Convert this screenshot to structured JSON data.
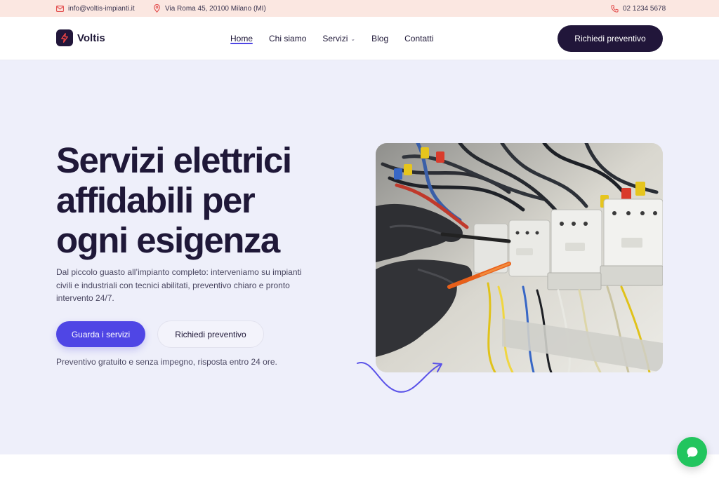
{
  "topbar": {
    "email": "info@voltis-impianti.it",
    "address": "Via Roma 45, 20100 Milano (MI)",
    "phone": "02 1234 5678",
    "email_icon": "mail-icon",
    "address_icon": "map-pin-icon",
    "phone_icon": "phone-icon"
  },
  "header": {
    "brand": "Voltis",
    "brand_icon": "lightning-bolt-icon",
    "nav": [
      {
        "label": "Home",
        "active": true
      },
      {
        "label": "Chi siamo"
      },
      {
        "label": "Servizi",
        "has_dropdown": true
      },
      {
        "label": "Blog"
      },
      {
        "label": "Contatti"
      }
    ],
    "cta": "Richiedi preventivo"
  },
  "hero": {
    "title_lines": [
      "Servizi elettrici",
      "affidabili per",
      "ogni esigenza"
    ],
    "description": "Dal piccolo guasto all’impianto completo: interveniamo su impianti civili e industriali con tecnici abilitati, preventivo chiaro e pronto intervento 24/7.",
    "primary_button": "Guarda i servizi",
    "secondary_button": "Richiedi preventivo",
    "note": "Preventivo gratuito e senza impegno, risposta entro 24 ore."
  },
  "chat": {
    "icon": "chat-bubble-icon"
  },
  "colors": {
    "topbar_bg": "#fbe7e1",
    "hero_bg": "#eeeffa",
    "dark": "#21163a",
    "accent": "#4f46e5",
    "icon_accent": "#e24a4a",
    "chat": "#22c55e"
  }
}
